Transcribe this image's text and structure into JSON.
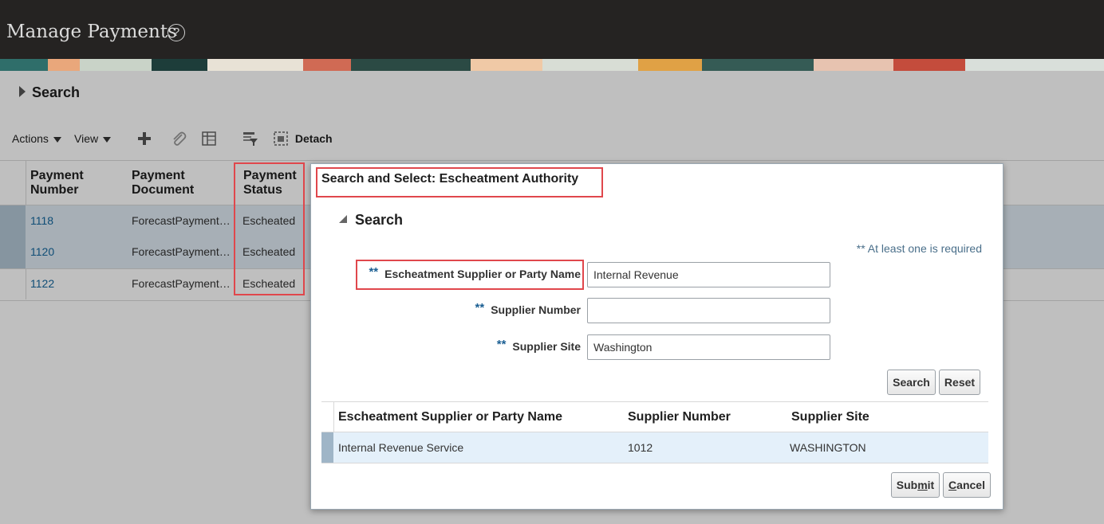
{
  "header": {
    "title": "Manage Payments",
    "help_glyph": "?"
  },
  "search_section": {
    "label": "Search"
  },
  "toolbar": {
    "actions_label": "Actions",
    "view_label": "View",
    "detach_label": "Detach",
    "icons": [
      "plus-icon",
      "paperclip-icon",
      "table-freeze-icon",
      "filter-icon",
      "detach-icon"
    ]
  },
  "payments_table": {
    "columns": [
      {
        "line1": "Payment",
        "line2": "Number"
      },
      {
        "line1": "Payment",
        "line2": "Document"
      },
      {
        "line1": "Payment",
        "line2": "Status"
      }
    ],
    "rows": [
      {
        "number": "1118",
        "document": "ForecastPayment…",
        "status": "Escheated"
      },
      {
        "number": "1120",
        "document": "ForecastPayment…",
        "status": "Escheated"
      },
      {
        "number": "1122",
        "document": "ForecastPayment…",
        "status": "Escheated"
      }
    ]
  },
  "dialog": {
    "title": "Search and Select: Escheatment Authority",
    "search_label": "Search",
    "required_note": "** At least one is required",
    "required_marker": "**",
    "fields": {
      "party_name": {
        "label": "Escheatment Supplier or Party Name",
        "value": "Internal Revenue"
      },
      "supplier_number": {
        "label": "Supplier Number",
        "value": ""
      },
      "supplier_site": {
        "label": "Supplier Site",
        "value": "Washington"
      }
    },
    "search_button": "Search",
    "reset_button": "Reset",
    "results": {
      "columns": [
        "Escheatment Supplier or Party Name",
        "Supplier Number",
        "Supplier Site"
      ],
      "rows": [
        {
          "name": "Internal Revenue Service",
          "number": "1012",
          "site": "WASHINGTON"
        }
      ]
    },
    "submit_button": {
      "pre": "Sub",
      "accel": "m",
      "post": "it"
    },
    "cancel_button": {
      "pre": "",
      "accel": "C",
      "post": "ancel"
    }
  },
  "colors": {
    "header_bg": "#252322",
    "link": "#14679e",
    "highlight": "#e0474c",
    "selected_row": "#e4f0fa"
  }
}
